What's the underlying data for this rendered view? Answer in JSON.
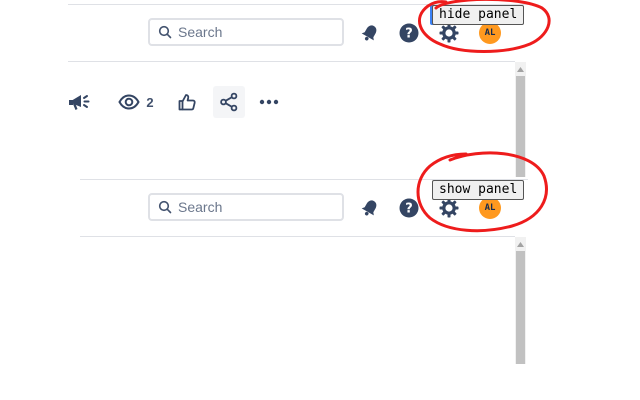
{
  "top_panel": {
    "search": {
      "placeholder": "Search",
      "value": ""
    },
    "tooltip": "hide panel",
    "avatar_initials": "AL"
  },
  "page_actions": {
    "watchers_count": "2"
  },
  "bottom_panel": {
    "search": {
      "placeholder": "Search",
      "value": ""
    },
    "tooltip": "show panel",
    "avatar_initials": "AL"
  },
  "colors": {
    "icon": "#344563",
    "avatar": "#ff991f",
    "annotation": "#ee1c1c",
    "divider": "#dfe1e6"
  }
}
